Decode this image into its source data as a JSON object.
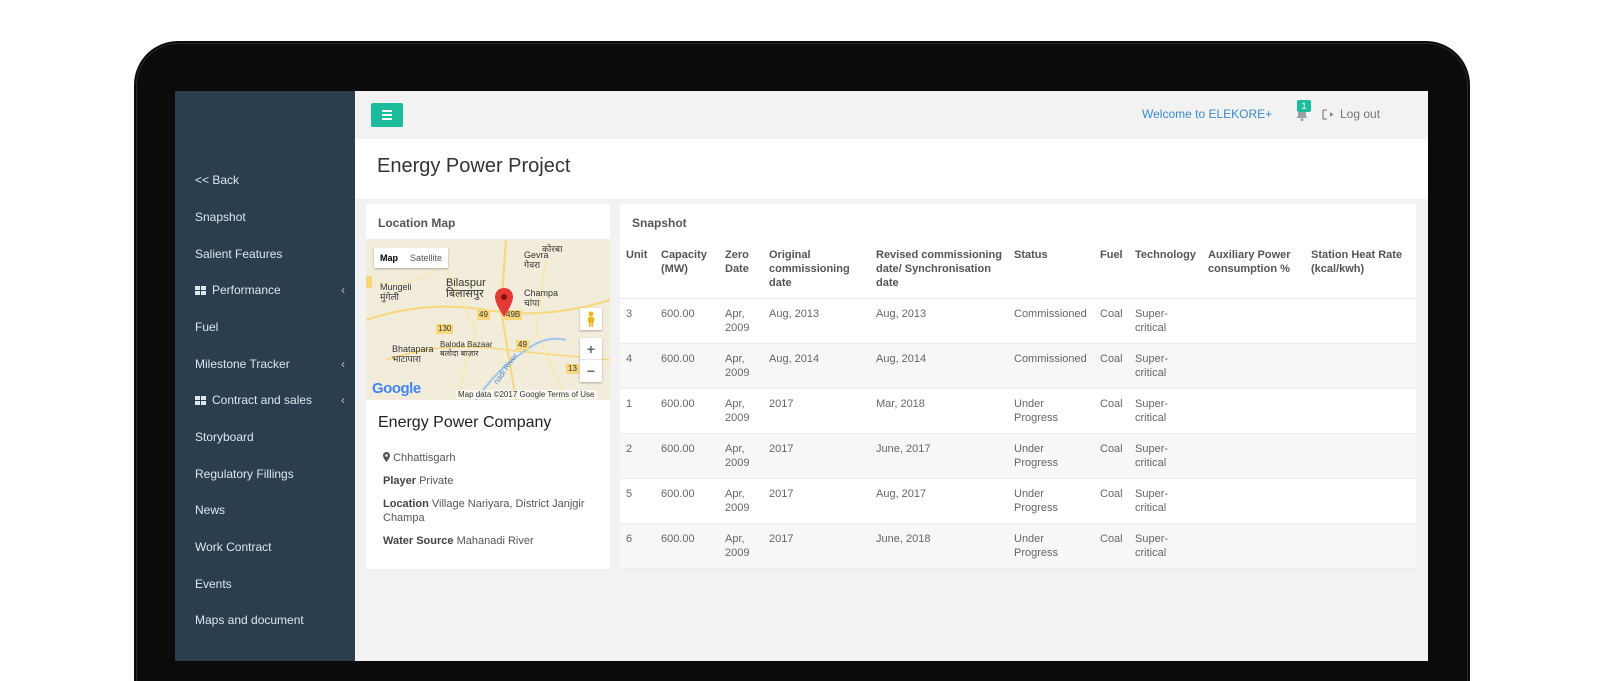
{
  "header": {
    "welcome": "Welcome to ELEKORE+",
    "notification_count": "1",
    "logout": "Log out"
  },
  "page_title": "Energy Power Project",
  "sidebar": {
    "items": [
      {
        "label": "<< Back"
      },
      {
        "label": "Snapshot"
      },
      {
        "label": "Salient Features"
      },
      {
        "label": "Performance",
        "has_icon": true,
        "chevron": "‹"
      },
      {
        "label": "Fuel"
      },
      {
        "label": "Milestone Tracker",
        "chevron": "‹"
      },
      {
        "label": "Contract and sales",
        "has_icon": true,
        "chevron": "‹"
      },
      {
        "label": "Storyboard"
      },
      {
        "label": "Regulatory Fillings"
      },
      {
        "label": "News"
      },
      {
        "label": "Work Contract"
      },
      {
        "label": "Events"
      },
      {
        "label": "Maps and document"
      }
    ]
  },
  "location": {
    "heading": "Location Map",
    "map": {
      "tab_map": "Map",
      "tab_satellite": "Satellite",
      "labels": {
        "gevra": "Gevra",
        "gevra_hi": "गेवरा",
        "korba_hi": "कोरबा",
        "mungeli": "Mungeli",
        "mungeli_hi": "मुंगेली",
        "bilaspur": "Bilaspur",
        "bilaspur_hi": "बिलासपुर",
        "champa": "Champa",
        "champa_hi": "चांपा",
        "bhatapara": "Bhatapara",
        "bhatapara_hi": "भाटापारा",
        "baloda": "Baloda Bazaar",
        "baloda_hi": "बलोदा बाज़ार",
        "road_130": "130",
        "road_49a": "49",
        "road_49b": "49B",
        "road_49c": "49",
        "road_13": "13",
        "river": "nadi River"
      },
      "zoom_in": "+",
      "zoom_out": "−",
      "brand": "Google",
      "footer": "Map data ©2017 Google    Terms of Use"
    },
    "company": "Energy Power Company",
    "state": "Chhattisgarh",
    "player_label": "Player",
    "player": "Private",
    "location_label": "Location",
    "location": "Village Nariyara, District Janjgir Champa",
    "water_label": "Water Source",
    "water": "Mahanadi River"
  },
  "snapshot": {
    "heading": "Snapshot",
    "columns": [
      "Unit",
      "Capacity (MW)",
      "Zero Date",
      "Original commissioning date",
      "Revised commissioning date/ Synchronisation date",
      "Status",
      "Fuel",
      "Technology",
      "Auxiliary Power consumption %",
      "Station Heat Rate (kcal/kwh)"
    ],
    "rows": [
      [
        "3",
        "600.00",
        "Apr, 2009",
        "Aug, 2013",
        "Aug, 2013",
        "Commissioned",
        "Coal",
        "Super-critical",
        "",
        ""
      ],
      [
        "4",
        "600.00",
        "Apr, 2009",
        "Aug, 2014",
        "Aug, 2014",
        "Commissioned",
        "Coal",
        "Super-critical",
        "",
        ""
      ],
      [
        "1",
        "600.00",
        "Apr, 2009",
        "2017",
        "Mar, 2018",
        "Under Progress",
        "Coal",
        "Super-critical",
        "",
        ""
      ],
      [
        "2",
        "600.00",
        "Apr, 2009",
        "2017",
        "June, 2017",
        "Under Progress",
        "Coal",
        "Super-critical",
        "",
        ""
      ],
      [
        "5",
        "600.00",
        "Apr, 2009",
        "2017",
        "Aug, 2017",
        "Under Progress",
        "Coal",
        "Super-critical",
        "",
        ""
      ],
      [
        "6",
        "600.00",
        "Apr, 2009",
        "2017",
        "June, 2018",
        "Under Progress",
        "Coal",
        "Super-critical",
        "",
        ""
      ]
    ]
  },
  "colors": {
    "sidebar": "#2b3e50",
    "accent": "#1abc9c",
    "link": "#3a8ccc"
  }
}
